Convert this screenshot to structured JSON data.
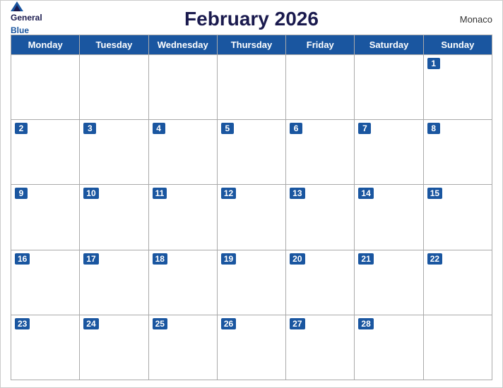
{
  "header": {
    "title": "February 2026",
    "country": "Monaco",
    "logo": {
      "general": "General",
      "blue": "Blue"
    }
  },
  "weekdays": [
    "Monday",
    "Tuesday",
    "Wednesday",
    "Thursday",
    "Friday",
    "Saturday",
    "Sunday"
  ],
  "weeks": [
    [
      null,
      null,
      null,
      null,
      null,
      null,
      1
    ],
    [
      2,
      3,
      4,
      5,
      6,
      7,
      8
    ],
    [
      9,
      10,
      11,
      12,
      13,
      14,
      15
    ],
    [
      16,
      17,
      18,
      19,
      20,
      21,
      22
    ],
    [
      23,
      24,
      25,
      26,
      27,
      28,
      null
    ]
  ]
}
